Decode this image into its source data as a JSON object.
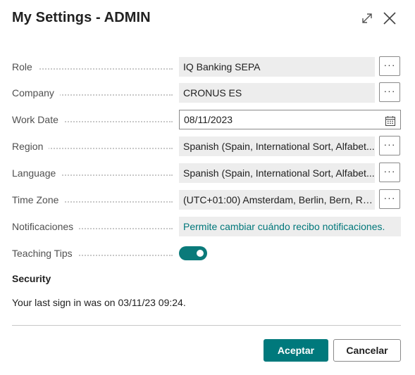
{
  "dialog": {
    "title": "My Settings - ADMIN"
  },
  "fields": {
    "role": {
      "label": "Role",
      "value": "IQ Banking SEPA"
    },
    "company": {
      "label": "Company",
      "value": "CRONUS ES"
    },
    "work_date": {
      "label": "Work Date",
      "value": "08/11/2023"
    },
    "region": {
      "label": "Region",
      "value": "Spanish (Spain, International Sort, Alfabet..."
    },
    "language": {
      "label": "Language",
      "value": "Spanish (Spain, International Sort, Alfabet..."
    },
    "time_zone": {
      "label": "Time Zone",
      "value": "(UTC+01:00) Amsterdam, Berlin, Bern, Ro..."
    },
    "notifications": {
      "label": "Notificaciones",
      "value": "Permite cambiar cuándo recibo notificaciones."
    },
    "teaching_tips": {
      "label": "Teaching Tips",
      "enabled": true
    }
  },
  "assist_label": "···",
  "security": {
    "title": "Security",
    "last_sign_in": "Your last sign in was on 03/11/23 09:24."
  },
  "buttons": {
    "ok": "Aceptar",
    "cancel": "Cancelar"
  },
  "icons": {
    "expand": "expand-icon",
    "close": "close-icon",
    "calendar": "calendar-icon"
  },
  "colors": {
    "accent": "#00797c",
    "link": "#00777a",
    "field_bg": "#ededed"
  }
}
